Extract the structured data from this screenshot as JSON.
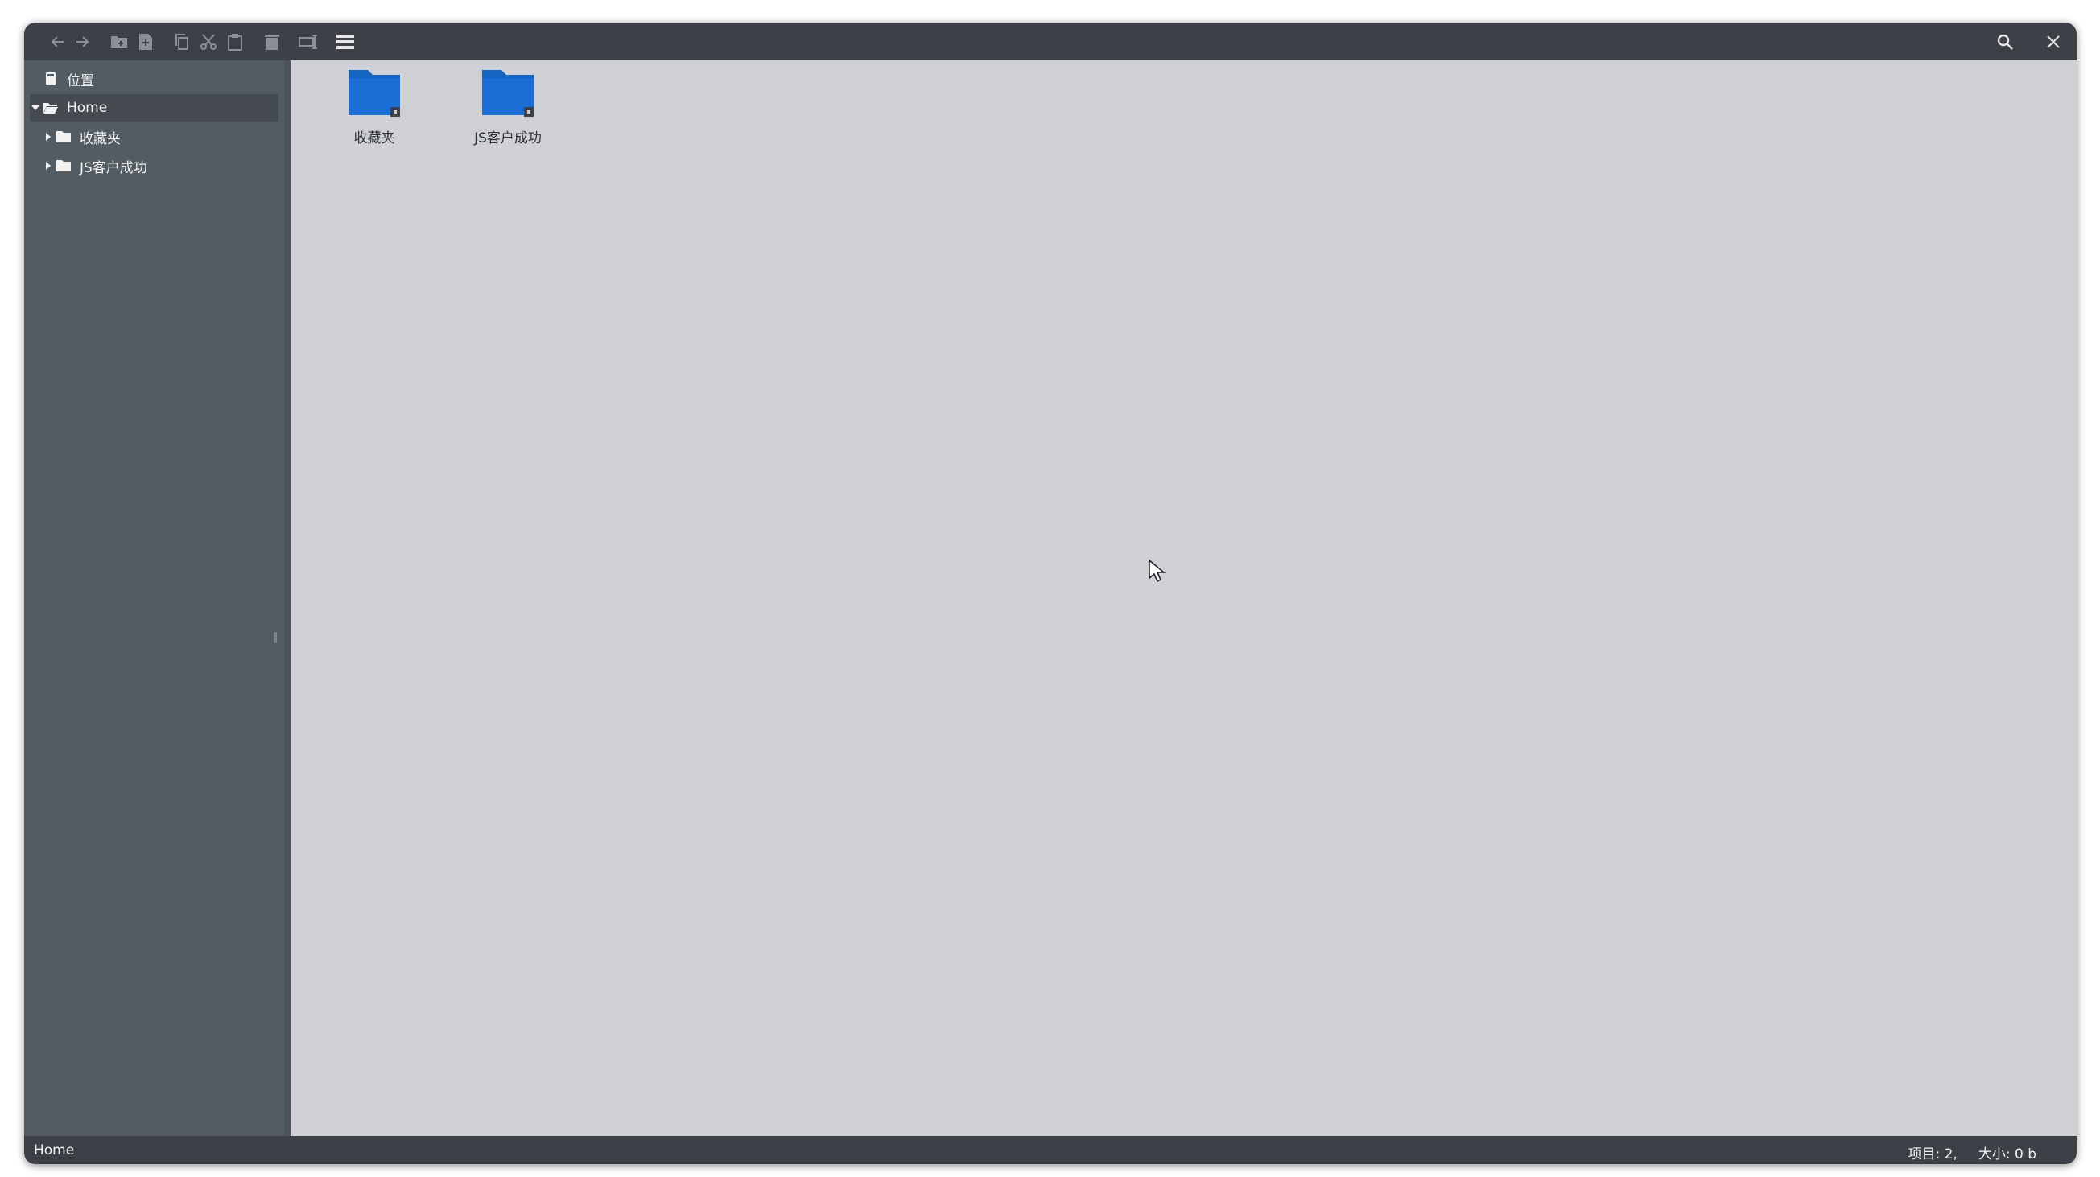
{
  "toolbar": {
    "buttons": [
      {
        "icon": "back-arrow-icon"
      },
      {
        "icon": "forward-arrow-icon"
      },
      {
        "icon": "new-folder-icon"
      },
      {
        "icon": "new-file-icon"
      },
      {
        "icon": "copy-icon"
      },
      {
        "icon": "cut-icon"
      },
      {
        "icon": "paste-icon"
      },
      {
        "icon": "trash-icon"
      },
      {
        "icon": "rename-icon"
      },
      {
        "icon": "list-view-icon"
      }
    ],
    "right": [
      {
        "icon": "search-icon"
      },
      {
        "icon": "close-icon"
      }
    ]
  },
  "sidebar": {
    "places_label": "位置",
    "home_label": "Home",
    "children": [
      {
        "label": "收藏夹"
      },
      {
        "label": "JS客户成功"
      }
    ]
  },
  "content": {
    "items": [
      {
        "label": "收藏夹"
      },
      {
        "label": "JS客户成功"
      }
    ]
  },
  "status": {
    "path": "Home",
    "items": "项目: 2,",
    "size": "大小: 0 b"
  },
  "colors": {
    "folder": "#1565c0",
    "toolbar": "#3d4147",
    "sidebar": "#535c62",
    "content": "#cfd0d5"
  }
}
